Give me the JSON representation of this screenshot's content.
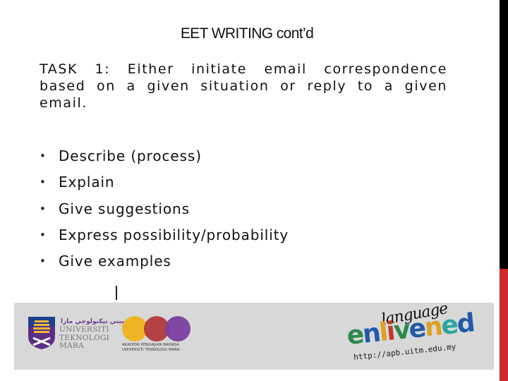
{
  "slide": {
    "title": "EET WRITING cont’d",
    "task_text": "TASK 1: Either initiate email correspondence based on a given situation or reply to a given email.",
    "bullet_glyph": "•",
    "bullets": [
      "Describe (process)",
      "Explain",
      "Give suggestions",
      "Express possibility/probability",
      "Give examples"
    ]
  },
  "footer": {
    "uitm_logo": {
      "jawi_text": "ﯾﻮﻧﯿﭭﺮﺳﯿﺘﻲ ﺗﻴﻜﻨﻮﻟﻮﺟﻲ ﻣﺎرا",
      "name_lines": [
        "UNIVERSITI",
        "TEKNOLOGI",
        "MARA"
      ]
    },
    "apb_logo": {
      "line1": "AKADEMI PENGAJIAN BAHASA",
      "line2": "UNIVERSITI TEKNOLOGI MARA",
      "circle_colors": [
        "#f0b429",
        "#b23a3a",
        "#7b3fa0"
      ]
    },
    "language_enlivened": {
      "script_word": "language",
      "main_letters": [
        "e",
        "n",
        "l",
        "i",
        "v",
        "e",
        "n",
        "e",
        "d"
      ],
      "letter_colors": [
        "#2a8a4a",
        "#1f5aa8",
        "#e0a020",
        "#c0392b",
        "#2a8a4a",
        "#1f5aa8",
        "#e0a020",
        "#2aa5a0",
        "#1f5aa8"
      ],
      "url": "http://apb.uitm.edu.my"
    }
  },
  "colors": {
    "accent_red": "#d0282e",
    "band_gray": "#d8d8d8"
  }
}
